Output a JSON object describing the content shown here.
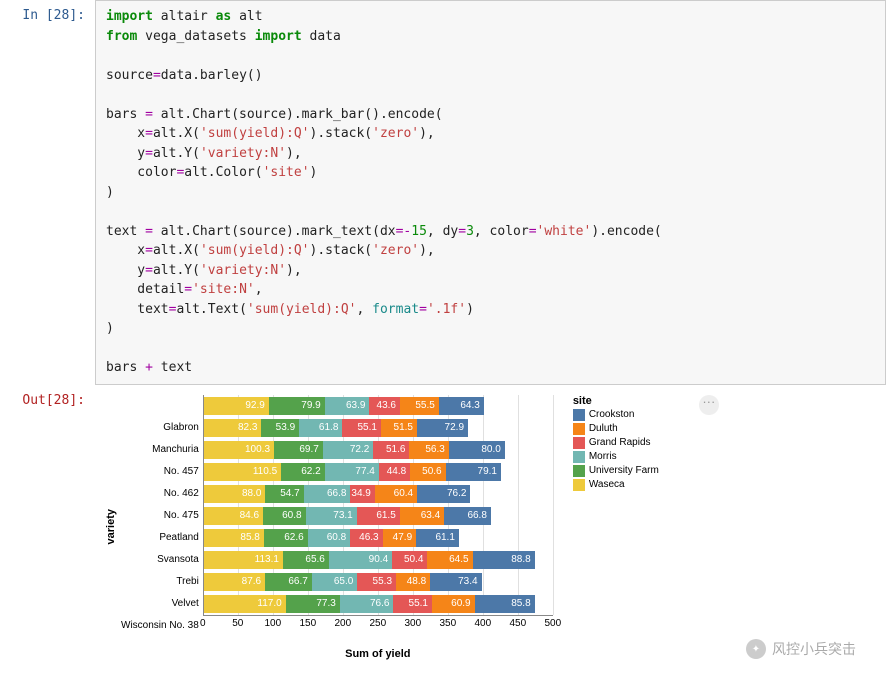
{
  "prompt_in": "In [28]:",
  "prompt_out": "Out[28]:",
  "code_tokens": [
    {
      "t": "import",
      "c": "kw-green"
    },
    {
      "t": " altair ",
      "c": "plain"
    },
    {
      "t": "as",
      "c": "kw-green"
    },
    {
      "t": " alt\n",
      "c": "plain"
    },
    {
      "t": "from",
      "c": "kw-green"
    },
    {
      "t": " vega_datasets ",
      "c": "plain"
    },
    {
      "t": "import",
      "c": "kw-green"
    },
    {
      "t": " data\n\n",
      "c": "plain"
    },
    {
      "t": "source",
      "c": "plain"
    },
    {
      "t": "=",
      "c": "op"
    },
    {
      "t": "data.barley()\n\n",
      "c": "plain"
    },
    {
      "t": "bars ",
      "c": "plain"
    },
    {
      "t": "=",
      "c": "op"
    },
    {
      "t": " alt.Chart(source).mark_bar().encode(\n",
      "c": "plain"
    },
    {
      "t": "    x",
      "c": "plain"
    },
    {
      "t": "=",
      "c": "op"
    },
    {
      "t": "alt.X(",
      "c": "plain"
    },
    {
      "t": "'sum(yield):Q'",
      "c": "str-red"
    },
    {
      "t": ").stack(",
      "c": "plain"
    },
    {
      "t": "'zero'",
      "c": "str-red"
    },
    {
      "t": "),\n",
      "c": "plain"
    },
    {
      "t": "    y",
      "c": "plain"
    },
    {
      "t": "=",
      "c": "op"
    },
    {
      "t": "alt.Y(",
      "c": "plain"
    },
    {
      "t": "'variety:N'",
      "c": "str-red"
    },
    {
      "t": "),\n",
      "c": "plain"
    },
    {
      "t": "    color",
      "c": "plain"
    },
    {
      "t": "=",
      "c": "op"
    },
    {
      "t": "alt.Color(",
      "c": "plain"
    },
    {
      "t": "'site'",
      "c": "str-red"
    },
    {
      "t": ")\n",
      "c": "plain"
    },
    {
      "t": ")\n\n",
      "c": "plain"
    },
    {
      "t": "text ",
      "c": "plain"
    },
    {
      "t": "=",
      "c": "op"
    },
    {
      "t": " alt.Chart(source).mark_text(dx",
      "c": "plain"
    },
    {
      "t": "=-",
      "c": "op"
    },
    {
      "t": "15",
      "c": "num-green"
    },
    {
      "t": ", dy",
      "c": "plain"
    },
    {
      "t": "=",
      "c": "op"
    },
    {
      "t": "3",
      "c": "num-green"
    },
    {
      "t": ", color",
      "c": "plain"
    },
    {
      "t": "=",
      "c": "op"
    },
    {
      "t": "'white'",
      "c": "str-red"
    },
    {
      "t": ").encode(\n",
      "c": "plain"
    },
    {
      "t": "    x",
      "c": "plain"
    },
    {
      "t": "=",
      "c": "op"
    },
    {
      "t": "alt.X(",
      "c": "plain"
    },
    {
      "t": "'sum(yield):Q'",
      "c": "str-red"
    },
    {
      "t": ").stack(",
      "c": "plain"
    },
    {
      "t": "'zero'",
      "c": "str-red"
    },
    {
      "t": "),\n",
      "c": "plain"
    },
    {
      "t": "    y",
      "c": "plain"
    },
    {
      "t": "=",
      "c": "op"
    },
    {
      "t": "alt.Y(",
      "c": "plain"
    },
    {
      "t": "'variety:N'",
      "c": "str-red"
    },
    {
      "t": "),\n",
      "c": "plain"
    },
    {
      "t": "    detail",
      "c": "plain"
    },
    {
      "t": "=",
      "c": "op"
    },
    {
      "t": "'site:N'",
      "c": "str-red"
    },
    {
      "t": ",\n",
      "c": "plain"
    },
    {
      "t": "    text",
      "c": "plain"
    },
    {
      "t": "=",
      "c": "op"
    },
    {
      "t": "alt.Text(",
      "c": "plain"
    },
    {
      "t": "'sum(yield):Q'",
      "c": "str-red"
    },
    {
      "t": ", ",
      "c": "plain"
    },
    {
      "t": "format",
      "c": "func-cyan"
    },
    {
      "t": "=",
      "c": "op"
    },
    {
      "t": "'.1f'",
      "c": "str-red"
    },
    {
      "t": ")\n",
      "c": "plain"
    },
    {
      "t": ")\n\n",
      "c": "plain"
    },
    {
      "t": "bars ",
      "c": "plain"
    },
    {
      "t": "+",
      "c": "op"
    },
    {
      "t": " text",
      "c": "plain"
    }
  ],
  "chart_data": {
    "type": "bar",
    "stacked": true,
    "ylabel": "variety",
    "xlabel": "Sum of yield",
    "xlim": [
      0,
      500
    ],
    "xticks": [
      0,
      50,
      100,
      150,
      200,
      250,
      300,
      350,
      400,
      450,
      500
    ],
    "categories": [
      "Glabron",
      "Manchuria",
      "No. 457",
      "No. 462",
      "No. 475",
      "Peatland",
      "Svansota",
      "Trebi",
      "Velvet",
      "Wisconsin No. 38"
    ],
    "site_order": [
      "Waseca",
      "University Farm",
      "Morris",
      "Grand Rapids",
      "Duluth",
      "Crookston"
    ],
    "colors": {
      "Crookston": "#4c78a8",
      "Duluth": "#f58518",
      "Grand Rapids": "#e45756",
      "Morris": "#72b7b2",
      "University Farm": "#54a24b",
      "Waseca": "#eeca3b"
    },
    "values": {
      "Glabron": {
        "Waseca": 92.9,
        "University Farm": 79.9,
        "Morris": 63.9,
        "Grand Rapids": 43.6,
        "Duluth": 55.5,
        "Crookston": 64.3
      },
      "Manchuria": {
        "Waseca": 82.3,
        "University Farm": 53.9,
        "Morris": 61.8,
        "Grand Rapids": 55.1,
        "Duluth": 51.5,
        "Crookston": 72.9
      },
      "No. 457": {
        "Waseca": 100.3,
        "University Farm": 69.7,
        "Morris": 72.2,
        "Grand Rapids": 51.6,
        "Duluth": 56.3,
        "Crookston": 80.0
      },
      "No. 462": {
        "Waseca": 110.5,
        "University Farm": 62.2,
        "Morris": 77.4,
        "Grand Rapids": 44.8,
        "Duluth": 50.6,
        "Crookston": 79.1
      },
      "No. 475": {
        "Waseca": 88.0,
        "University Farm": 54.7,
        "Morris": 66.8,
        "Grand Rapids": 34.9,
        "Duluth": 60.4,
        "Crookston": 76.2
      },
      "Peatland": {
        "Waseca": 84.6,
        "University Farm": 60.8,
        "Morris": 73.1,
        "Grand Rapids": 61.5,
        "Duluth": 63.4,
        "Crookston": 66.8
      },
      "Svansota": {
        "Waseca": 85.8,
        "University Farm": 62.6,
        "Morris": 60.8,
        "Grand Rapids": 46.3,
        "Duluth": 47.9,
        "Crookston": 61.1
      },
      "Trebi": {
        "Waseca": 113.1,
        "University Farm": 65.6,
        "Morris": 90.4,
        "Grand Rapids": 50.4,
        "Duluth": 64.5,
        "Crookston": 88.8
      },
      "Velvet": {
        "Waseca": 87.6,
        "University Farm": 66.7,
        "Morris": 65.0,
        "Grand Rapids": 55.3,
        "Duluth": 48.8,
        "Crookston": 73.4
      },
      "Wisconsin No. 38": {
        "Waseca": 117.0,
        "University Farm": 77.3,
        "Morris": 76.6,
        "Grand Rapids": 55.1,
        "Duluth": 60.9,
        "Crookston": 85.8
      }
    },
    "legend_title": "site",
    "legend_items": [
      "Crookston",
      "Duluth",
      "Grand Rapids",
      "Morris",
      "University Farm",
      "Waseca"
    ]
  },
  "actions_label": "···",
  "watermark": "风控小兵突击"
}
